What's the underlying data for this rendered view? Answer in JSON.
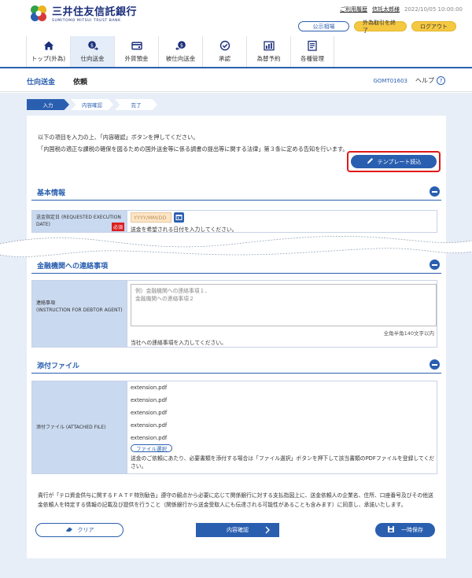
{
  "header": {
    "bank_name_ja": "三井住友信託銀行",
    "bank_name_en": "SUMITOMO MITSUI TRUST BANK",
    "usage_history": "ご利用履歴",
    "user_name": "信託太郎様",
    "timestamp": "2022/10/05 10:00:00",
    "public_rate": "公示相場",
    "fx_end": "外為取引を終了",
    "logout": "ログアウト"
  },
  "nav": {
    "items": [
      {
        "label": "トップ(外為)",
        "icon": "home-icon"
      },
      {
        "label": "仕向送金",
        "icon": "money-send-icon"
      },
      {
        "label": "外貨預金",
        "icon": "deposit-card-icon"
      },
      {
        "label": "被仕向送金",
        "icon": "money-receive-icon"
      },
      {
        "label": "承認",
        "icon": "approve-check-icon"
      },
      {
        "label": "為替予約",
        "icon": "forex-reservation-icon"
      },
      {
        "label": "各種管理",
        "icon": "management-icon"
      }
    ],
    "active_index": 1
  },
  "page": {
    "title": "仕向送金",
    "subtitle": "依頼",
    "screen_id": "GOMT01603",
    "help": "ヘルプ"
  },
  "steps": [
    "入力",
    "内容確認",
    "完了"
  ],
  "intro": {
    "line1": "以下の項目を入力の上、「内容確認」ボタンを押してください。",
    "line2": "「内国税の適正な課税の確保を図るための国外送金等に係る調書の提出等に関する法律」第３条に定める告知を行います。"
  },
  "template_button": "テンプレート読込",
  "basic_info": {
    "title": "基本情報",
    "date_label_ja": "送金指定日",
    "date_label_en": "(REQUESTED EXECUTION DATE)",
    "required": "必須",
    "date_placeholder": "YYYY/MM/DD",
    "date_hint": "送金を希望される日付を入力してください。"
  },
  "contact": {
    "title": "金融機関への連絡事項",
    "label_ja": "連絡事項",
    "label_en": "(INSTRUCTION FOR DEBTOR AGENT)",
    "placeholder_line1": "例）金融機関への連絡事項１、",
    "placeholder_line2": "金融機関への連絡事項２",
    "counter": "全角半角140文字以内",
    "hint": "当社への連絡事項を入力してください。"
  },
  "attachments": {
    "title": "添付ファイル",
    "label": "添付ファイル (ATTACHED FILE)",
    "files": [
      "extension.pdf",
      "extension.pdf",
      "extension.pdf",
      "extension.pdf",
      "extension.pdf"
    ],
    "select_button": "ファイル選択",
    "note": "送金のご依頼にあたり、必要書類を添付する場合は「ファイル選択」ボタンを押下して該当書類のPDFファイルを登録してください。"
  },
  "footer": {
    "note": "貴行が「テロ資金供与に関するＦＡＴＦ特別勧告」遵守の観点から必要に応じて関係銀行に対する支払指図上に、送金依頼人の企業名、住所、口座番号及びその他送金依頼人を特定する情報の記載及び提供を行うこと（関係銀行から送金受取人にも伝達される可能性があることも含みます）に同意し、承諾いたします。",
    "clear": "クリア",
    "confirm": "内容確認",
    "save": "一時保存"
  }
}
